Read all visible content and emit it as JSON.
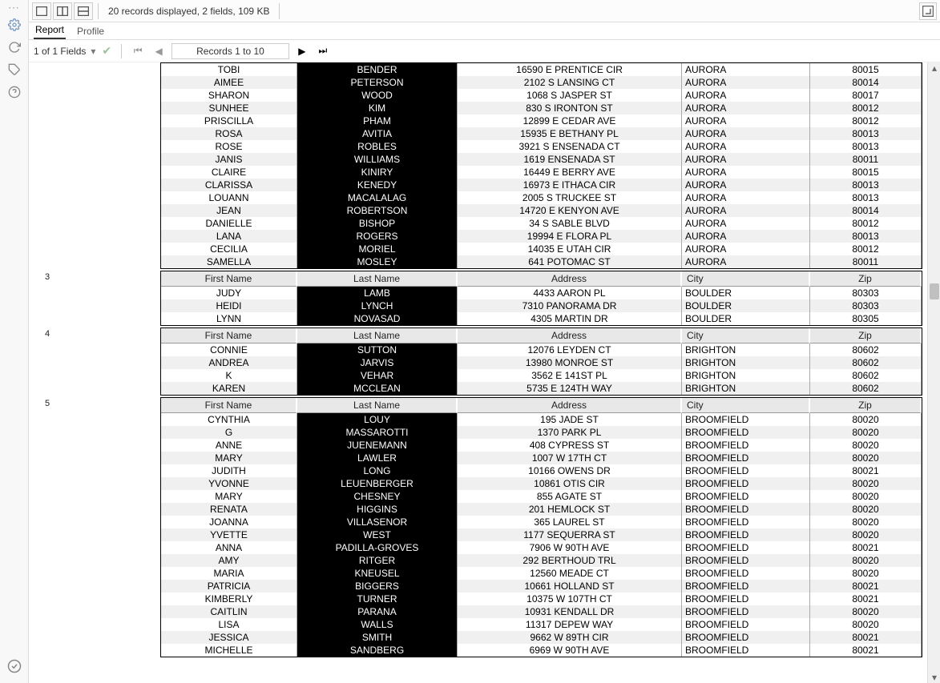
{
  "toolbar": {
    "info": "20 records displayed, 2 fields, 109 KB"
  },
  "tabs": {
    "report": "Report",
    "profile": "Profile"
  },
  "nav": {
    "fields": "1 of 1 Fields",
    "records": "Records 1 to 10"
  },
  "columns": {
    "first": "First Name",
    "last": "Last Name",
    "address": "Address",
    "city": "City",
    "zip": "Zip"
  },
  "groups": [
    {
      "num": "",
      "showHeader": false,
      "rows": [
        {
          "first": "TOBI",
          "last": "BENDER",
          "address": "16590 E PRENTICE CIR",
          "city": "AURORA",
          "zip": "80015"
        },
        {
          "first": "AIMEE",
          "last": "PETERSON",
          "address": "2102 S LANSING CT",
          "city": "AURORA",
          "zip": "80014"
        },
        {
          "first": "SHARON",
          "last": "WOOD",
          "address": "1068 S JASPER ST",
          "city": "AURORA",
          "zip": "80017"
        },
        {
          "first": "SUNHEE",
          "last": "KIM",
          "address": "830 S IRONTON ST",
          "city": "AURORA",
          "zip": "80012"
        },
        {
          "first": "PRISCILLA",
          "last": "PHAM",
          "address": "12899 E CEDAR AVE",
          "city": "AURORA",
          "zip": "80012"
        },
        {
          "first": "ROSA",
          "last": "AVITIA",
          "address": "15935 E BETHANY PL",
          "city": "AURORA",
          "zip": "80013"
        },
        {
          "first": "ROSE",
          "last": "ROBLES",
          "address": "3921 S ENSENADA CT",
          "city": "AURORA",
          "zip": "80013"
        },
        {
          "first": "JANIS",
          "last": "WILLIAMS",
          "address": "1619 ENSENADA ST",
          "city": "AURORA",
          "zip": "80011"
        },
        {
          "first": "CLAIRE",
          "last": "KINIRY",
          "address": "16449 E BERRY AVE",
          "city": "AURORA",
          "zip": "80015"
        },
        {
          "first": "CLARISSA",
          "last": "KENEDY",
          "address": "16973 E ITHACA CIR",
          "city": "AURORA",
          "zip": "80013"
        },
        {
          "first": "LOUANN",
          "last": "MACALALAG",
          "address": "2005 S TRUCKEE ST",
          "city": "AURORA",
          "zip": "80013"
        },
        {
          "first": "JEAN",
          "last": "ROBERTSON",
          "address": "14720 E KENYON AVE",
          "city": "AURORA",
          "zip": "80014"
        },
        {
          "first": "DANIELLE",
          "last": "BISHOP",
          "address": "34 S SABLE BLVD",
          "city": "AURORA",
          "zip": "80012"
        },
        {
          "first": "LANA",
          "last": "ROGERS",
          "address": "19994 E FLORA PL",
          "city": "AURORA",
          "zip": "80013"
        },
        {
          "first": "CECILIA",
          "last": "MORIEL",
          "address": "14035 E UTAH CIR",
          "city": "AURORA",
          "zip": "80012"
        },
        {
          "first": "SAMELLA",
          "last": "MOSLEY",
          "address": "641 POTOMAC ST",
          "city": "AURORA",
          "zip": "80011"
        }
      ]
    },
    {
      "num": "3",
      "showHeader": true,
      "rows": [
        {
          "first": "JUDY",
          "last": "LAMB",
          "address": "4433 AARON PL",
          "city": "BOULDER",
          "zip": "80303"
        },
        {
          "first": "HEIDI",
          "last": "LYNCH",
          "address": "7310 PANORAMA DR",
          "city": "BOULDER",
          "zip": "80303"
        },
        {
          "first": "LYNN",
          "last": "NOVASAD",
          "address": "4305 MARTIN DR",
          "city": "BOULDER",
          "zip": "80305"
        }
      ]
    },
    {
      "num": "4",
      "showHeader": true,
      "rows": [
        {
          "first": "CONNIE",
          "last": "SUTTON",
          "address": "12076 LEYDEN CT",
          "city": "BRIGHTON",
          "zip": "80602"
        },
        {
          "first": "ANDREA",
          "last": "JARVIS",
          "address": "13980 MONROE ST",
          "city": "BRIGHTON",
          "zip": "80602"
        },
        {
          "first": "K",
          "last": "VEHAR",
          "address": "3562 E 141ST PL",
          "city": "BRIGHTON",
          "zip": "80602"
        },
        {
          "first": "KAREN",
          "last": "MCCLEAN",
          "address": "5735 E 124TH WAY",
          "city": "BRIGHTON",
          "zip": "80602"
        }
      ]
    },
    {
      "num": "5",
      "showHeader": true,
      "rows": [
        {
          "first": "CYNTHIA",
          "last": "LOUY",
          "address": "195 JADE ST",
          "city": "BROOMFIELD",
          "zip": "80020"
        },
        {
          "first": "G",
          "last": "MASSAROTTI",
          "address": "1370 PARK PL",
          "city": "BROOMFIELD",
          "zip": "80020"
        },
        {
          "first": "ANNE",
          "last": "JUENEMANN",
          "address": "408 CYPRESS ST",
          "city": "BROOMFIELD",
          "zip": "80020"
        },
        {
          "first": "MARY",
          "last": "LAWLER",
          "address": "1007 W 17TH CT",
          "city": "BROOMFIELD",
          "zip": "80020"
        },
        {
          "first": "JUDITH",
          "last": "LONG",
          "address": "10166 OWENS DR",
          "city": "BROOMFIELD",
          "zip": "80021"
        },
        {
          "first": "YVONNE",
          "last": "LEUENBERGER",
          "address": "10861 OTIS CIR",
          "city": "BROOMFIELD",
          "zip": "80020"
        },
        {
          "first": "MARY",
          "last": "CHESNEY",
          "address": "855 AGATE ST",
          "city": "BROOMFIELD",
          "zip": "80020"
        },
        {
          "first": "RENATA",
          "last": "HIGGINS",
          "address": "201 HEMLOCK ST",
          "city": "BROOMFIELD",
          "zip": "80020"
        },
        {
          "first": "JOANNA",
          "last": "VILLASENOR",
          "address": "365 LAUREL ST",
          "city": "BROOMFIELD",
          "zip": "80020"
        },
        {
          "first": "YVETTE",
          "last": "WEST",
          "address": "1177 SEQUERRA ST",
          "city": "BROOMFIELD",
          "zip": "80020"
        },
        {
          "first": "ANNA",
          "last": "PADILLA-GROVES",
          "address": "7906 W 90TH AVE",
          "city": "BROOMFIELD",
          "zip": "80021"
        },
        {
          "first": "AMY",
          "last": "RITGER",
          "address": "292 BERTHOUD TRL",
          "city": "BROOMFIELD",
          "zip": "80020"
        },
        {
          "first": "MARIA",
          "last": "KNEUSEL",
          "address": "12560 MEADE CT",
          "city": "BROOMFIELD",
          "zip": "80020"
        },
        {
          "first": "PATRICIA",
          "last": "BIGGERS",
          "address": "10661 HOLLAND ST",
          "city": "BROOMFIELD",
          "zip": "80021"
        },
        {
          "first": "KIMBERLY",
          "last": "TURNER",
          "address": "10375 W 107TH CT",
          "city": "BROOMFIELD",
          "zip": "80021"
        },
        {
          "first": "CAITLIN",
          "last": "PARANA",
          "address": "10931 KENDALL DR",
          "city": "BROOMFIELD",
          "zip": "80020"
        },
        {
          "first": "LISA",
          "last": "WALLS",
          "address": "11317 DEPEW WAY",
          "city": "BROOMFIELD",
          "zip": "80020"
        },
        {
          "first": "JESSICA",
          "last": "SMITH",
          "address": "9662 W 89TH CIR",
          "city": "BROOMFIELD",
          "zip": "80021"
        },
        {
          "first": "MICHELLE",
          "last": "SANDBERG",
          "address": "6969 W 90TH AVE",
          "city": "BROOMFIELD",
          "zip": "80021"
        }
      ]
    }
  ]
}
